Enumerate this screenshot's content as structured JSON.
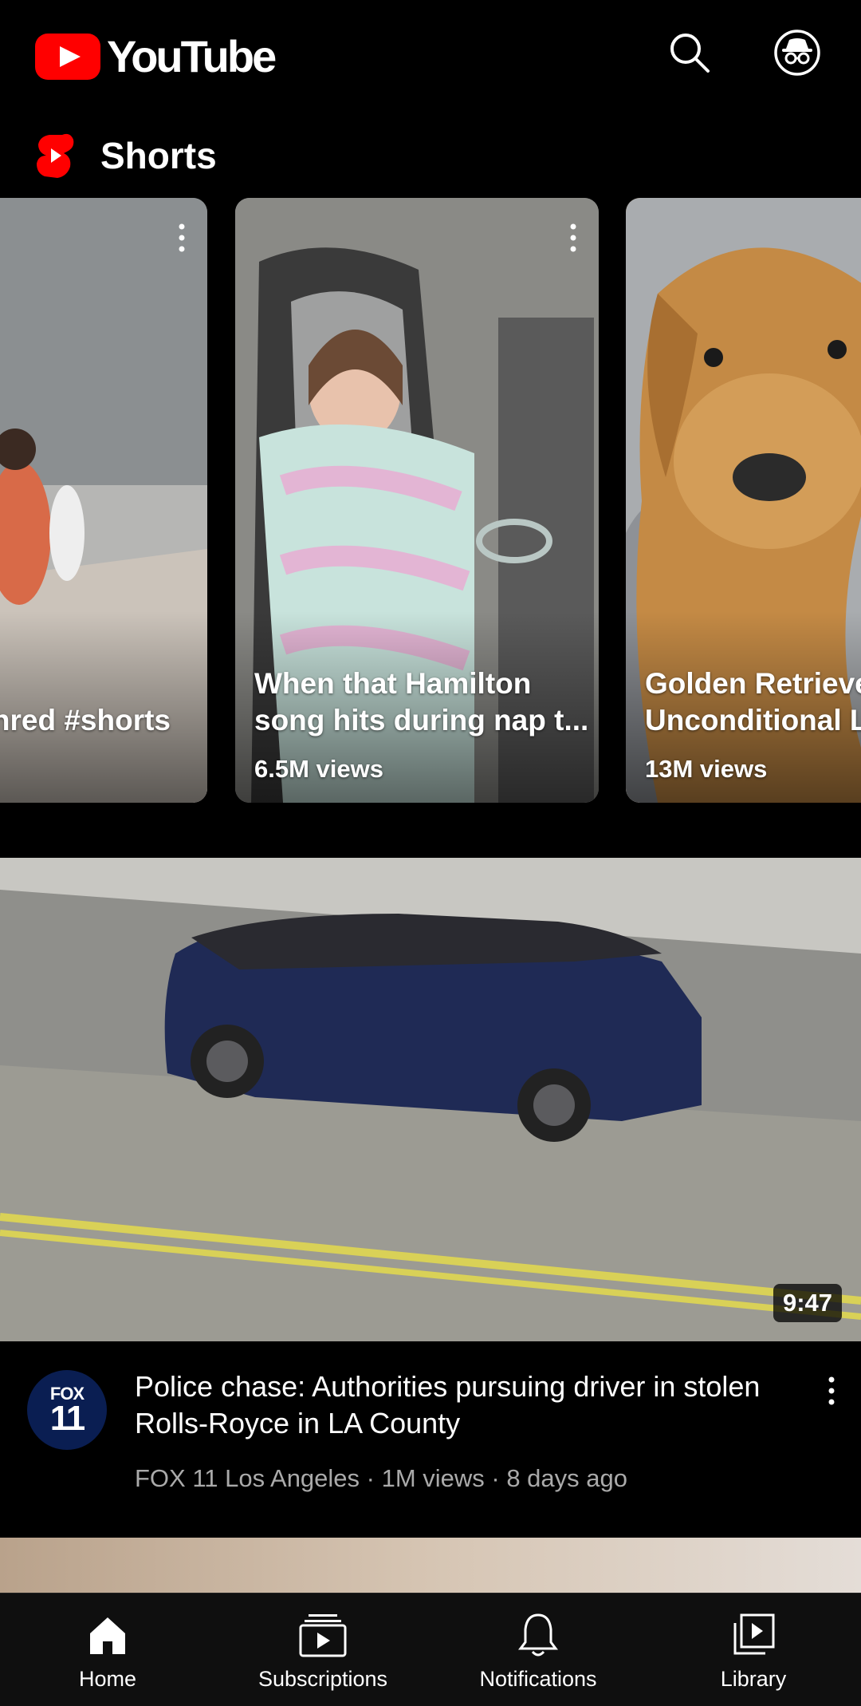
{
  "header": {
    "app_name": "YouTube"
  },
  "shorts": {
    "section_title": "Shorts",
    "items": [
      {
        "title": "nred #shorts",
        "views": ""
      },
      {
        "title": "When that Hamilton song hits during nap t...",
        "views": "6.5M views"
      },
      {
        "title": "Golden Retrieve Unconditional L",
        "views": "13M views"
      }
    ]
  },
  "video": {
    "duration": "9:47",
    "title": "Police chase: Authorities pursuing driver in stolen Rolls-Royce in LA County",
    "subtitle": "FOX 11 Los Angeles · 1M views · 8 days ago",
    "channel_avatar": {
      "top": "FOX",
      "bottom": "11"
    }
  },
  "bottom_nav": {
    "items": [
      {
        "label": "Home",
        "icon": "home-icon"
      },
      {
        "label": "Subscriptions",
        "icon": "subscriptions-icon"
      },
      {
        "label": "Notifications",
        "icon": "bell-icon"
      },
      {
        "label": "Library",
        "icon": "library-icon"
      }
    ]
  },
  "colors": {
    "brand_red": "#ff0000",
    "background": "#000000",
    "secondary_text": "#aaaaaa"
  }
}
